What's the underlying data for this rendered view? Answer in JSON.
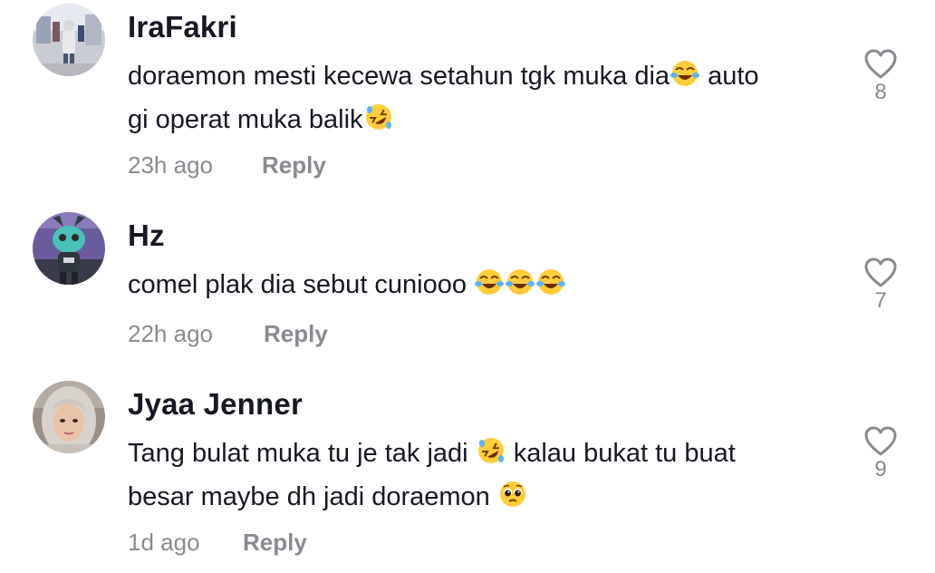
{
  "comments": [
    {
      "username": "IraFakri",
      "text_line1_a": "doraemon mesti kecewa setahun tgk muka dia",
      "text_line1_b": " auto",
      "text_line2": "gi operat muka balik",
      "time": "23h ago",
      "reply_label": "Reply",
      "like_count": "8",
      "emojis": [
        "face-with-tears-of-joy-emoji",
        "rolling-on-floor-laughing-emoji"
      ]
    },
    {
      "username": "Hz",
      "text_line1_a": "comel plak dia sebut cuniooo ",
      "time": "22h ago",
      "reply_label": "Reply",
      "like_count": "7",
      "emojis": [
        "face-with-tears-of-joy-emoji",
        "face-with-tears-of-joy-emoji",
        "face-with-tears-of-joy-emoji"
      ]
    },
    {
      "username": "Jyaa Jenner",
      "text_line1_a": "Tang bulat muka tu je tak jadi ",
      "text_line1_b": " kalau bukat tu buat",
      "text_line2": "besar maybe dh jadi doraemon ",
      "time": "1d ago",
      "reply_label": "Reply",
      "like_count": "9",
      "emojis": [
        "rolling-on-floor-laughing-emoji",
        "pleading-face-emoji"
      ]
    }
  ],
  "colors": {
    "primary_text": "#161823",
    "secondary_text": "#8a8b91",
    "heart_outline": "#8a8b91",
    "background": "#ffffff"
  },
  "icons": {
    "like": "heart-outline-icon"
  }
}
